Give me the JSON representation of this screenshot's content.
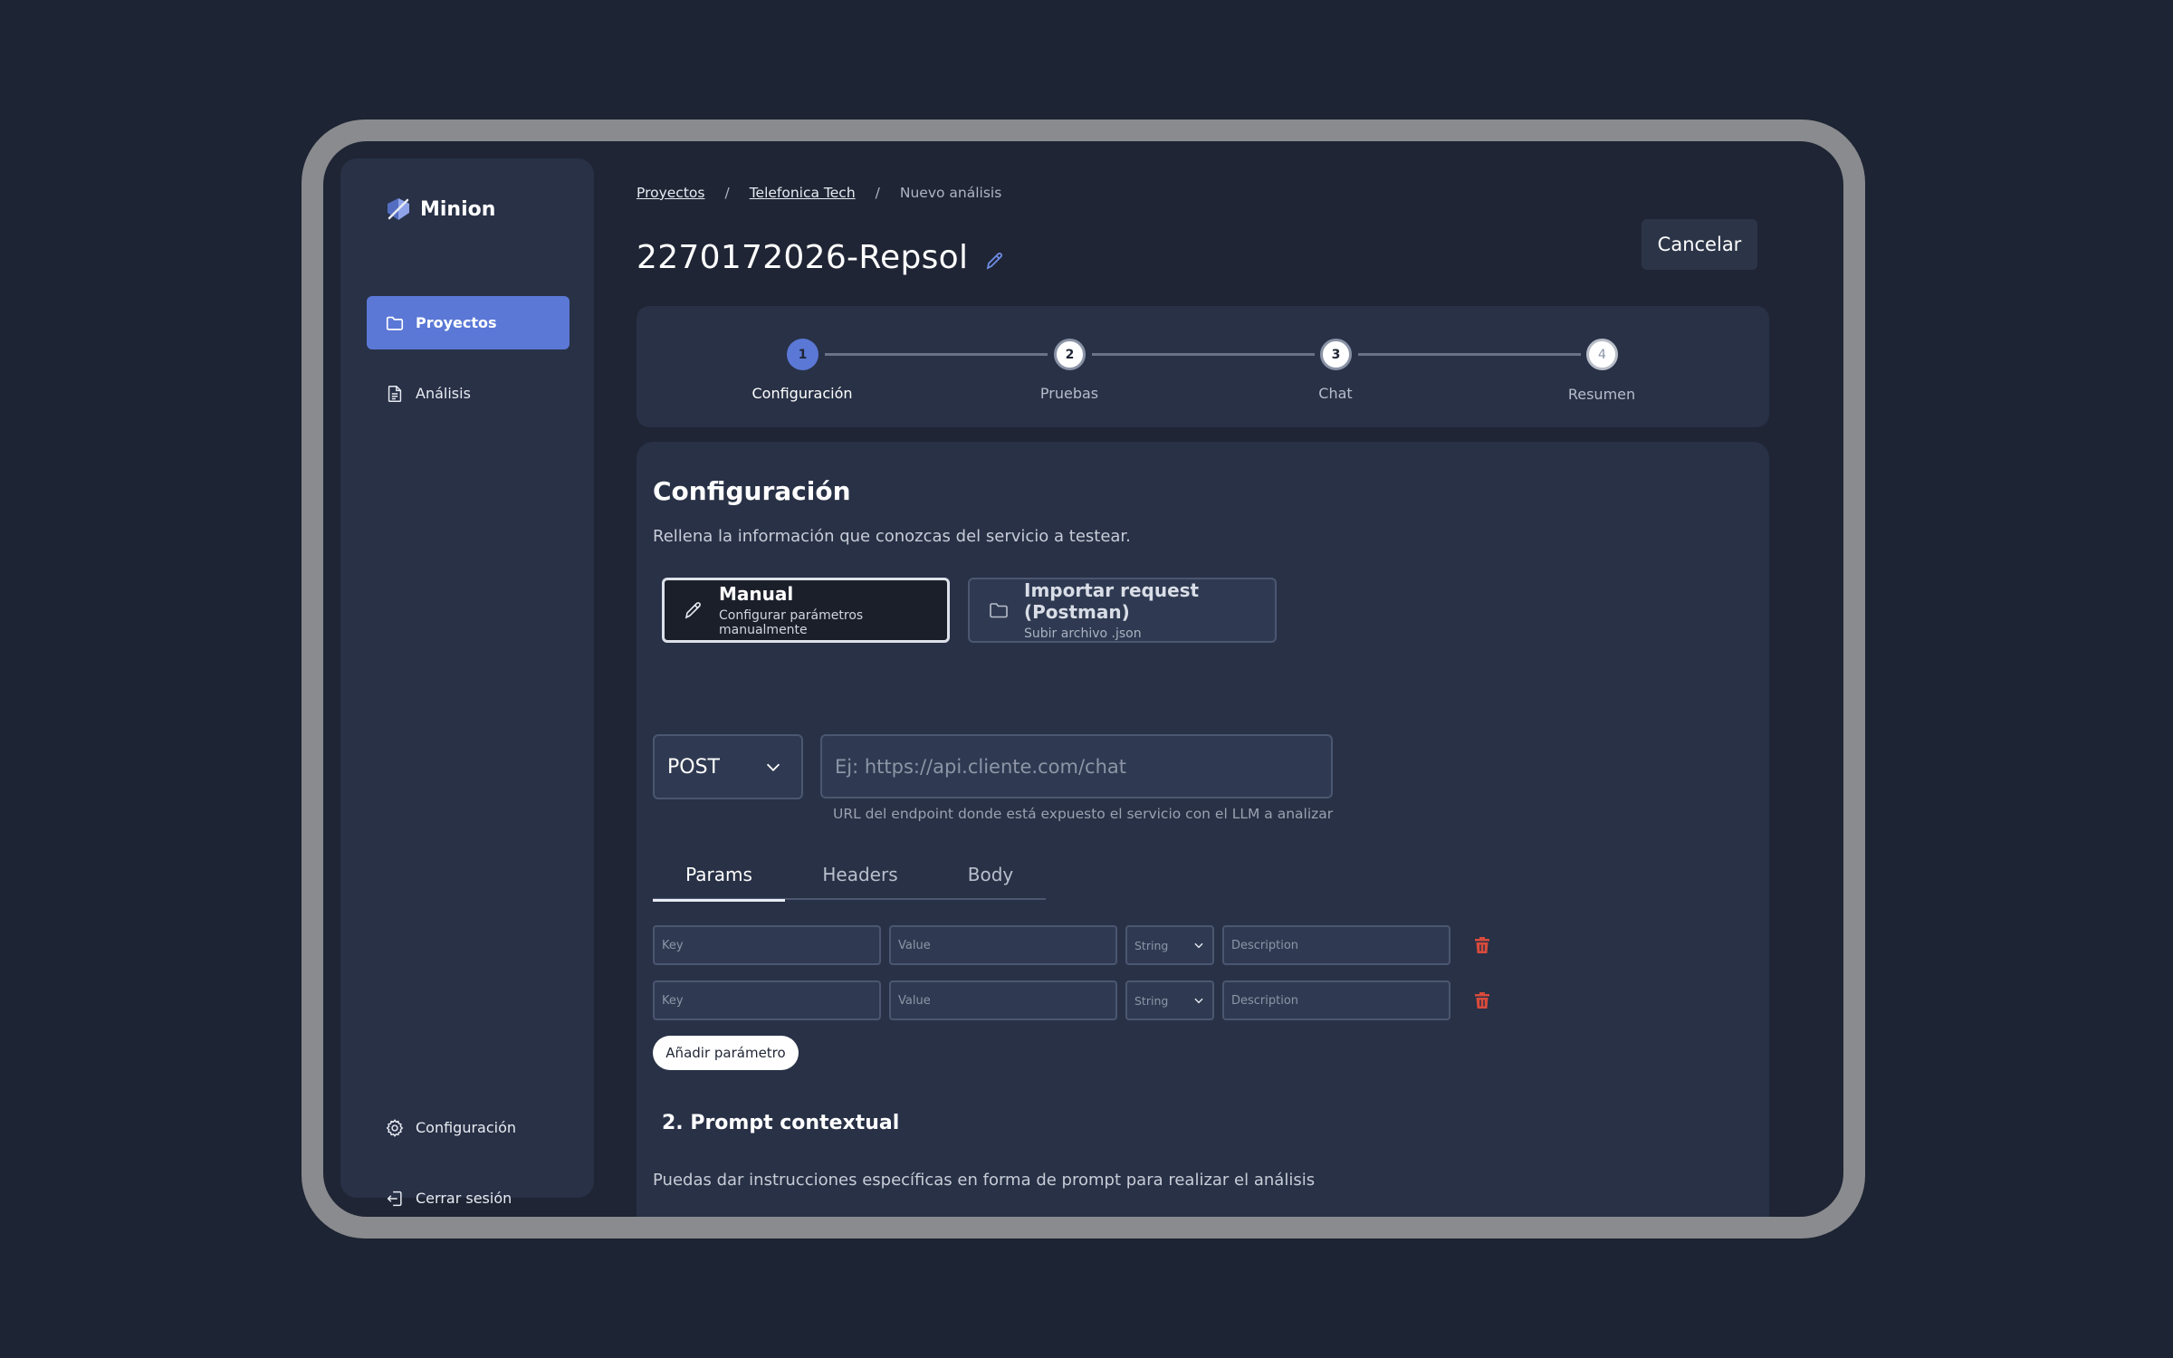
{
  "app": {
    "name": "Minion"
  },
  "sidebar": {
    "nav": [
      {
        "label": "Proyectos",
        "icon": "folder-icon",
        "active": true
      },
      {
        "label": "Análisis",
        "icon": "document-icon",
        "active": false
      }
    ],
    "bottom": [
      {
        "label": "Configuración",
        "icon": "gear-icon"
      },
      {
        "label": "Cerrar sesión",
        "icon": "logout-icon"
      }
    ]
  },
  "breadcrumb": {
    "items": [
      "Proyectos",
      "Telefonica Tech",
      "Nuevo análisis"
    ],
    "separator": "/"
  },
  "page": {
    "title": "2270172026-Repsol",
    "cancel_label": "Cancelar"
  },
  "stepper": {
    "steps": [
      {
        "number": "1",
        "label": "Configuración",
        "state": "active"
      },
      {
        "number": "2",
        "label": "Pruebas",
        "state": "upcoming"
      },
      {
        "number": "3",
        "label": "Chat",
        "state": "upcoming"
      },
      {
        "number": "4",
        "label": "Resumen",
        "state": "disabled"
      }
    ]
  },
  "config": {
    "title": "Configuración",
    "subtitle": "Rellena la información que conozcas del servicio a testear.",
    "modes": [
      {
        "title": "Manual",
        "description": "Configurar parámetros manualmente",
        "icon": "pencil-icon",
        "selected": true
      },
      {
        "title": "Importar request (Postman)",
        "description": "Subir archivo .json",
        "icon": "folder-icon",
        "selected": false
      }
    ],
    "method": "POST",
    "url": {
      "value": "",
      "placeholder": "Ej: https://api.cliente.com/chat",
      "hint": "URL del endpoint donde está expuesto el servicio con el LLM a analizar"
    },
    "tabs": [
      {
        "label": "Params",
        "active": true
      },
      {
        "label": "Headers",
        "active": false
      },
      {
        "label": "Body",
        "active": false
      }
    ],
    "params": [
      {
        "key_placeholder": "Key",
        "value_placeholder": "Value",
        "type": "String",
        "description_placeholder": "Description"
      },
      {
        "key_placeholder": "Key",
        "value_placeholder": "Value",
        "type": "String",
        "description_placeholder": "Description"
      }
    ],
    "add_param_label": "Añadir parámetro"
  },
  "prompt_section": {
    "title": "2. Prompt contextual",
    "description": "Puedas dar instrucciones específicas en forma de prompt para realizar el análisis"
  },
  "colors": {
    "accent": "#5b78d6",
    "danger": "#d84b3c",
    "background": "#1f2534",
    "panel": "#283146"
  }
}
